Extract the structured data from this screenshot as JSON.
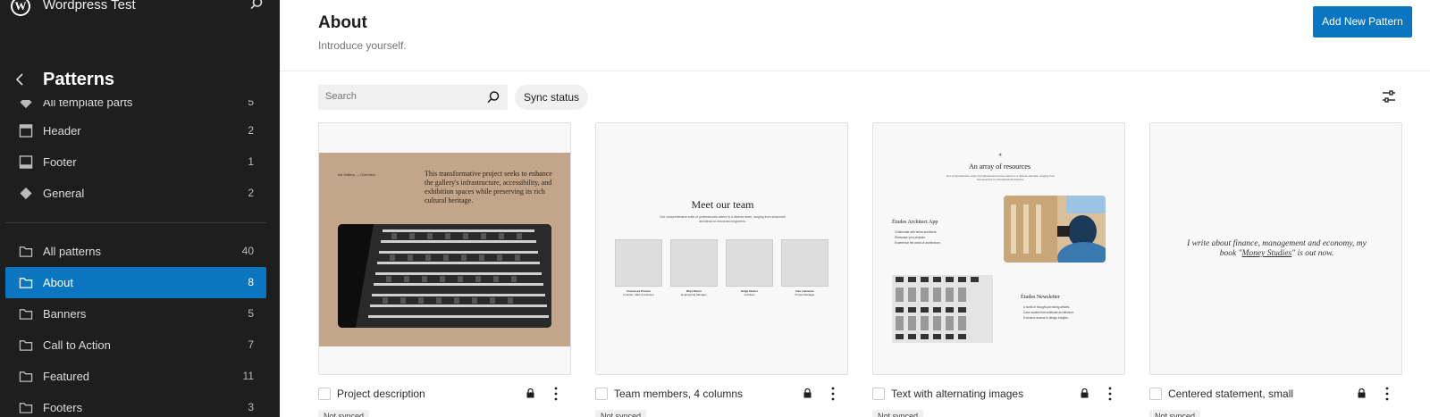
{
  "sidebar": {
    "site_title": "Wordpress Test",
    "section_title": "Patterns",
    "items": [
      {
        "label": "All template parts",
        "count": "5"
      },
      {
        "label": "Header",
        "count": "2"
      },
      {
        "label": "Footer",
        "count": "1"
      },
      {
        "label": "General",
        "count": "2"
      },
      {
        "label": "All patterns",
        "count": "40"
      },
      {
        "label": "About",
        "count": "8"
      },
      {
        "label": "Banners",
        "count": "5"
      },
      {
        "label": "Call to Action",
        "count": "7"
      },
      {
        "label": "Featured",
        "count": "11"
      },
      {
        "label": "Footers",
        "count": "3"
      }
    ]
  },
  "header": {
    "title": "About",
    "description": "Introduce yourself.",
    "add_button": "Add New Pattern"
  },
  "toolbar": {
    "search_placeholder": "Search",
    "sync_button": "Sync status"
  },
  "cards": [
    {
      "title": "Project description",
      "badge": "Not synced",
      "preview": {
        "small_label": "Art Gallery — Overview",
        "text": "This transformative project seeks to enhance the gallery's infrastructure, accessibility, and exhibition spaces while preserving its rich cultural heritage."
      }
    },
    {
      "title": "Team members, 4 columns",
      "badge": "Not synced",
      "preview": {
        "heading": "Meet our team",
        "sub": "Our comprehensive suite of professionals caters to a diverse team, ranging from seasoned architects to renowned engineers.",
        "members": [
          {
            "name": "Francesca Piovani",
            "role": "Founder, CEO & Architect"
          },
          {
            "name": "Rhye Moore",
            "role": "Engineering Manager"
          },
          {
            "name": "Helga Steiner",
            "role": "Architect"
          },
          {
            "name": "Ivan Lawrence",
            "role": "Project Manager"
          }
        ]
      }
    },
    {
      "title": "Text with alternating images",
      "badge": "Not synced",
      "preview": {
        "star": "✳",
        "heading": "An array of resources",
        "sub": "Our comprehensive suite of professional services caters to a diverse clientele, ranging from homeowners to commercial developers.",
        "app_title": "Études Architect App",
        "app_items": [
          "Collaborate with fellow architects.",
          "Showcase your projects.",
          "Experience the world of architecture."
        ],
        "news_title": "Études Newsletter",
        "news_items": [
          "A world of thought-provoking articles.",
          "Case studies that celebrate architecture.",
          "Exclusive access to design insights."
        ]
      }
    },
    {
      "title": "Centered statement, small",
      "badge": "Not synced",
      "preview": {
        "line1": "I write about finance, management and economy, my",
        "line2_pre": "book \"",
        "line2_link": "Money Studies",
        "line2_post": "\" is out now."
      }
    }
  ],
  "colors": {
    "accent": "#0a76c2",
    "sidebar_bg": "#1e1e1e",
    "card1_bg": "#c3a68a"
  }
}
